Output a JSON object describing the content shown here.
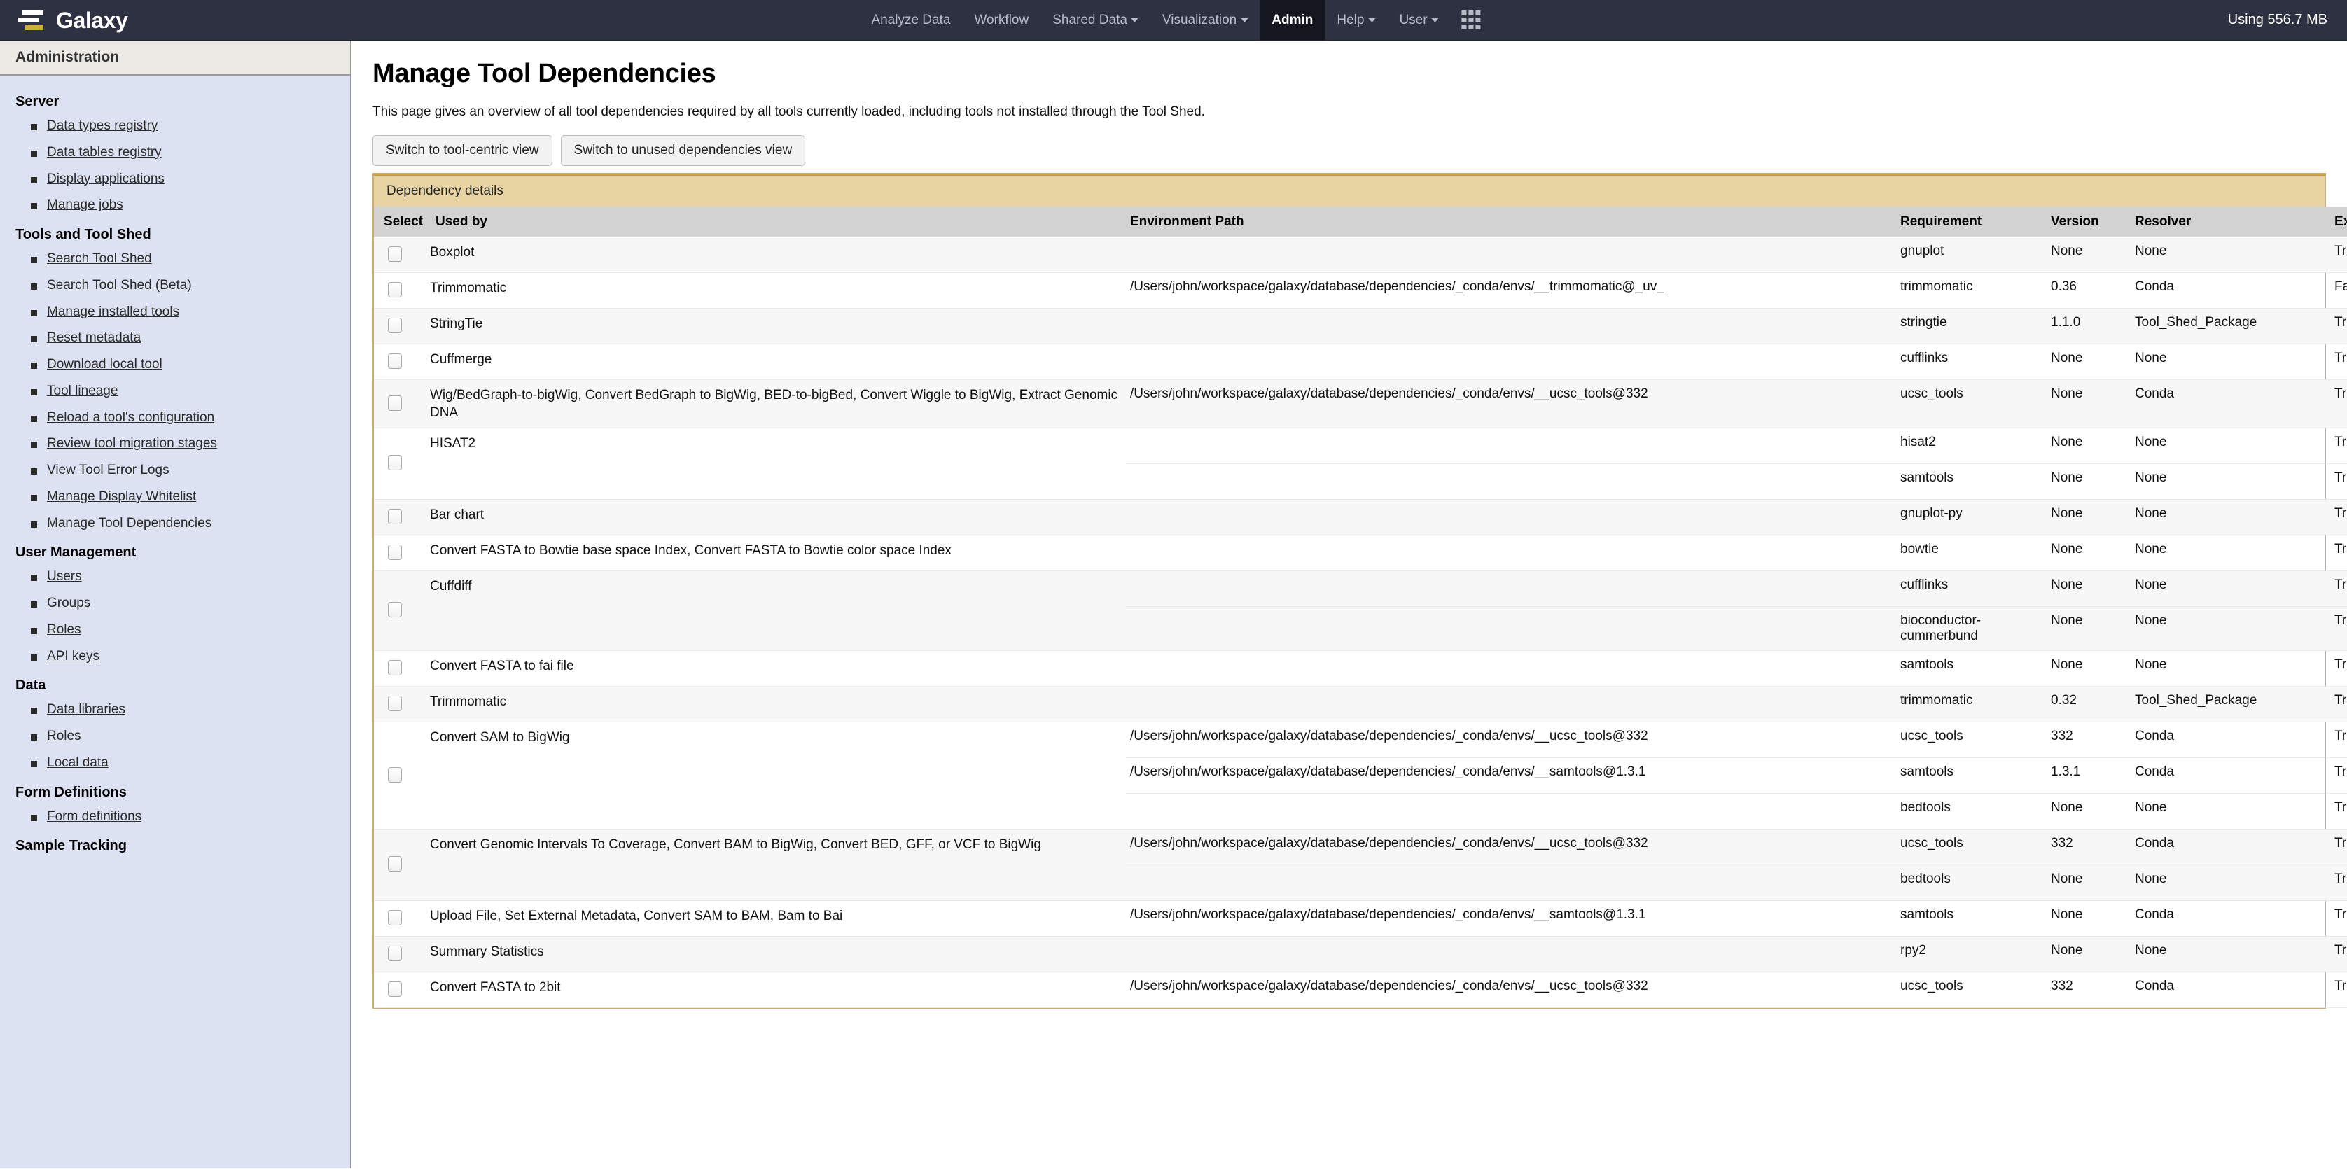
{
  "navbar": {
    "brand": "Galaxy",
    "items": [
      {
        "label": "Analyze Data",
        "caret": false,
        "active": false
      },
      {
        "label": "Workflow",
        "caret": false,
        "active": false
      },
      {
        "label": "Shared Data",
        "caret": true,
        "active": false
      },
      {
        "label": "Visualization",
        "caret": true,
        "active": false
      },
      {
        "label": "Admin",
        "caret": false,
        "active": true
      },
      {
        "label": "Help",
        "caret": true,
        "active": false
      },
      {
        "label": "User",
        "caret": true,
        "active": false
      }
    ],
    "grid_icon": "grid-apps-icon",
    "memory_usage": "Using 556.7 MB"
  },
  "sidebar": {
    "header": "Administration",
    "groups": [
      {
        "title": "Server",
        "items": [
          "Data types registry",
          "Data tables registry",
          "Display applications",
          "Manage jobs"
        ]
      },
      {
        "title": "Tools and Tool Shed",
        "items": [
          "Search Tool Shed",
          "Search Tool Shed (Beta)",
          "Manage installed tools",
          "Reset metadata",
          "Download local tool",
          "Tool lineage",
          "Reload a tool's configuration",
          "Review tool migration stages",
          "View Tool Error Logs",
          "Manage Display Whitelist",
          "Manage Tool Dependencies"
        ]
      },
      {
        "title": "User Management",
        "items": [
          "Users",
          "Groups",
          "Roles",
          "API keys"
        ]
      },
      {
        "title": "Data",
        "items": [
          "Data libraries",
          "Roles",
          "Local data"
        ]
      },
      {
        "title": "Form Definitions",
        "items": [
          "Form definitions"
        ]
      },
      {
        "title": "Sample Tracking",
        "items": []
      }
    ]
  },
  "main": {
    "title": "Manage Tool Dependencies",
    "description": "This page gives an overview of all tool dependencies required by all tools currently loaded, including tools not installed through the Tool Shed.",
    "buttons": [
      "Switch to tool-centric view",
      "Switch to unused dependencies view"
    ],
    "panel_title": "Dependency details",
    "columns": [
      "Select",
      "Used by",
      "Environment Path",
      "Requirement",
      "Version",
      "Resolver",
      "Exact",
      ""
    ],
    "rows": [
      {
        "used_by": "Boxplot",
        "reqs": [
          {
            "env_path": "",
            "requirement": "gnuplot",
            "version": "None",
            "resolver": "None",
            "exact": "True",
            "status": "error"
          }
        ]
      },
      {
        "used_by": "Trimmomatic",
        "reqs": [
          {
            "env_path": "/Users/john/workspace/galaxy/database/dependencies/_conda/envs/__trimmomatic@_uv_",
            "requirement": "trimmomatic",
            "version": "0.36",
            "resolver": "Conda",
            "exact": "False",
            "status": "warning"
          }
        ]
      },
      {
        "used_by": "StringTie",
        "reqs": [
          {
            "env_path": "",
            "requirement": "stringtie",
            "version": "1.1.0",
            "resolver": "Tool_Shed_Package",
            "exact": "True",
            "status": "ok"
          }
        ]
      },
      {
        "used_by": "Cuffmerge",
        "reqs": [
          {
            "env_path": "",
            "requirement": "cufflinks",
            "version": "None",
            "resolver": "None",
            "exact": "True",
            "status": "error"
          }
        ]
      },
      {
        "used_by": "Wig/BedGraph-to-bigWig, Convert BedGraph to BigWig, BED-to-bigBed, Convert Wiggle to BigWig, Extract Genomic DNA",
        "reqs": [
          {
            "env_path": "/Users/john/workspace/galaxy/database/dependencies/_conda/envs/__ucsc_tools@332",
            "requirement": "ucsc_tools",
            "version": "None",
            "resolver": "Conda",
            "exact": "True",
            "status": "ok"
          }
        ]
      },
      {
        "used_by": "HISAT2",
        "reqs": [
          {
            "env_path": "",
            "requirement": "hisat2",
            "version": "None",
            "resolver": "None",
            "exact": "True",
            "status": "error"
          },
          {
            "env_path": "",
            "requirement": "samtools",
            "version": "None",
            "resolver": "None",
            "exact": "True",
            "status": "error"
          }
        ]
      },
      {
        "used_by": "Bar chart",
        "reqs": [
          {
            "env_path": "",
            "requirement": "gnuplot-py",
            "version": "None",
            "resolver": "None",
            "exact": "True",
            "status": "error"
          }
        ]
      },
      {
        "used_by": "Convert FASTA to Bowtie base space Index, Convert FASTA to Bowtie color space Index",
        "reqs": [
          {
            "env_path": "",
            "requirement": "bowtie",
            "version": "None",
            "resolver": "None",
            "exact": "True",
            "status": "error"
          }
        ]
      },
      {
        "used_by": "Cuffdiff",
        "reqs": [
          {
            "env_path": "",
            "requirement": "cufflinks",
            "version": "None",
            "resolver": "None",
            "exact": "True",
            "status": "error"
          },
          {
            "env_path": "",
            "requirement": "bioconductor-cummerbund",
            "version": "None",
            "resolver": "None",
            "exact": "True",
            "status": "error"
          }
        ]
      },
      {
        "used_by": "Convert FASTA to fai file",
        "reqs": [
          {
            "env_path": "",
            "requirement": "samtools",
            "version": "None",
            "resolver": "None",
            "exact": "True",
            "status": "error"
          }
        ]
      },
      {
        "used_by": "Trimmomatic",
        "reqs": [
          {
            "env_path": "",
            "requirement": "trimmomatic",
            "version": "0.32",
            "resolver": "Tool_Shed_Package",
            "exact": "True",
            "status": "ok"
          }
        ]
      },
      {
        "used_by": "Convert SAM to BigWig",
        "reqs": [
          {
            "env_path": "/Users/john/workspace/galaxy/database/dependencies/_conda/envs/__ucsc_tools@332",
            "requirement": "ucsc_tools",
            "version": "332",
            "resolver": "Conda",
            "exact": "True",
            "status": "ok"
          },
          {
            "env_path": "/Users/john/workspace/galaxy/database/dependencies/_conda/envs/__samtools@1.3.1",
            "requirement": "samtools",
            "version": "1.3.1",
            "resolver": "Conda",
            "exact": "True",
            "status": "ok"
          },
          {
            "env_path": "",
            "requirement": "bedtools",
            "version": "None",
            "resolver": "None",
            "exact": "True",
            "status": "error"
          }
        ]
      },
      {
        "used_by": "Convert Genomic Intervals To Coverage, Convert BAM to BigWig, Convert BED, GFF, or VCF to BigWig",
        "reqs": [
          {
            "env_path": "/Users/john/workspace/galaxy/database/dependencies/_conda/envs/__ucsc_tools@332",
            "requirement": "ucsc_tools",
            "version": "332",
            "resolver": "Conda",
            "exact": "True",
            "status": "ok"
          },
          {
            "env_path": "",
            "requirement": "bedtools",
            "version": "None",
            "resolver": "None",
            "exact": "True",
            "status": "error"
          }
        ]
      },
      {
        "used_by": "Upload File, Set External Metadata, Convert SAM to BAM, Bam to Bai",
        "reqs": [
          {
            "env_path": "/Users/john/workspace/galaxy/database/dependencies/_conda/envs/__samtools@1.3.1",
            "requirement": "samtools",
            "version": "None",
            "resolver": "Conda",
            "exact": "True",
            "status": "ok"
          }
        ]
      },
      {
        "used_by": "Summary Statistics",
        "reqs": [
          {
            "env_path": "",
            "requirement": "rpy2",
            "version": "None",
            "resolver": "None",
            "exact": "True",
            "status": "error"
          }
        ]
      },
      {
        "used_by": "Convert FASTA to 2bit",
        "reqs": [
          {
            "env_path": "/Users/john/workspace/galaxy/database/dependencies/_conda/envs/__ucsc_tools@332",
            "requirement": "ucsc_tools",
            "version": "332",
            "resolver": "Conda",
            "exact": "True",
            "status": "ok"
          }
        ]
      }
    ]
  }
}
